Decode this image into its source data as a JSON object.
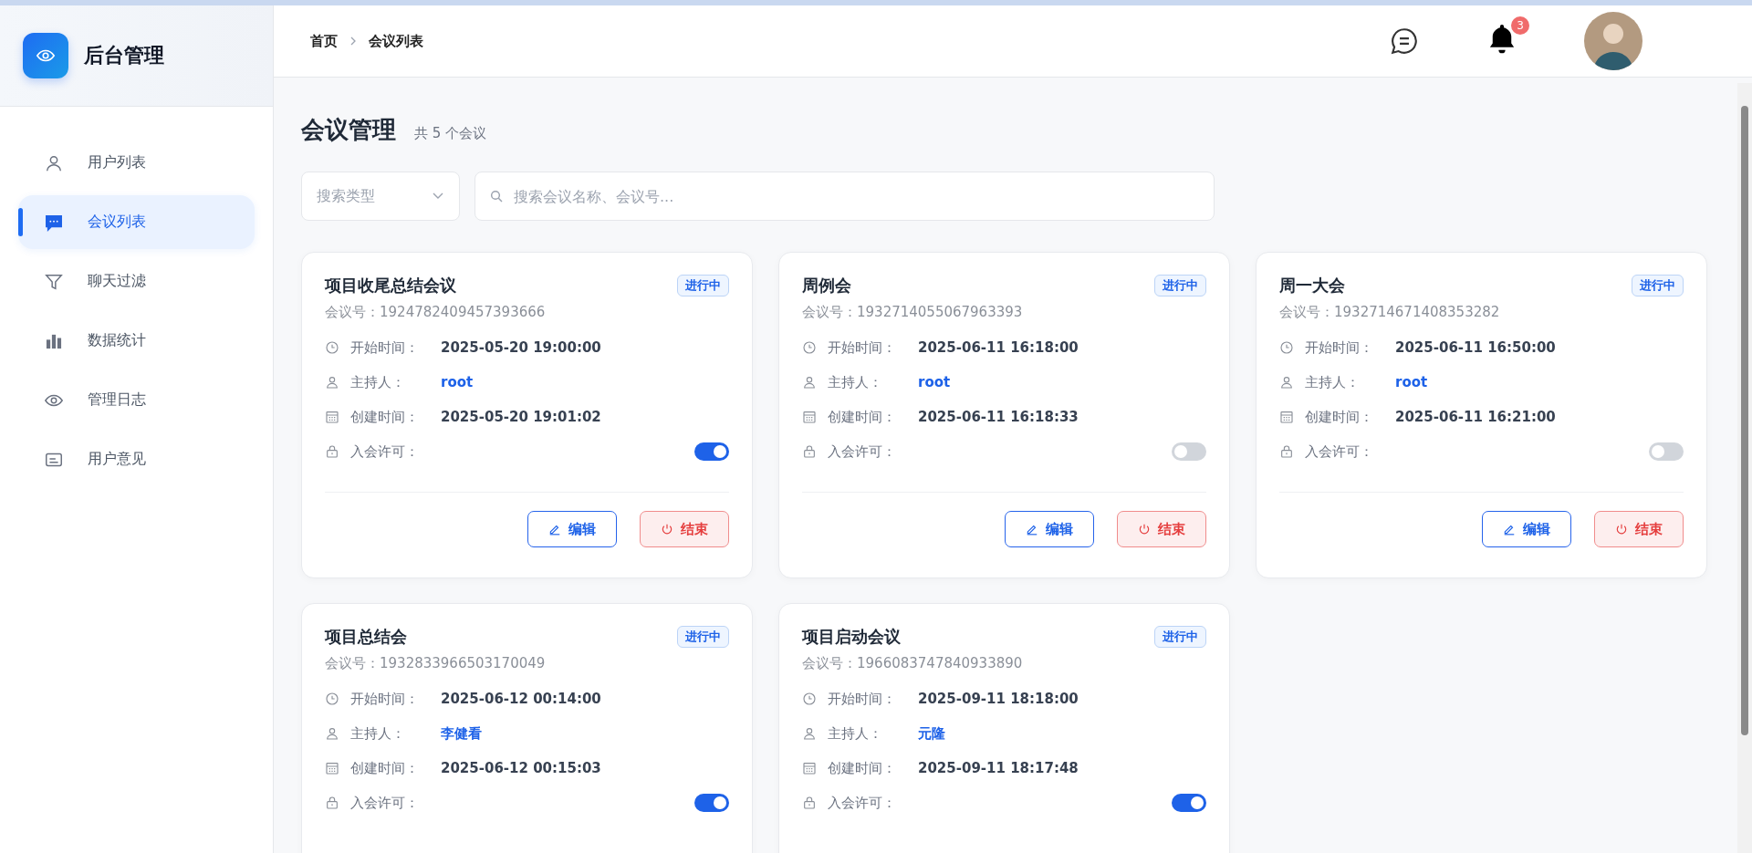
{
  "sidebar": {
    "brand": "后台管理",
    "items": [
      {
        "label": "用户列表",
        "selected": false
      },
      {
        "label": "会议列表",
        "selected": true
      },
      {
        "label": "聊天过滤",
        "selected": false
      },
      {
        "label": "数据统计",
        "selected": false
      },
      {
        "label": "管理日志",
        "selected": false
      },
      {
        "label": "用户意见",
        "selected": false
      }
    ]
  },
  "header": {
    "breadcrumb": [
      "首页",
      "会议列表"
    ],
    "notification_count": "3"
  },
  "page": {
    "title": "会议管理",
    "count": "共 5 个会议"
  },
  "filters": {
    "type_placeholder": "搜索类型",
    "search_placeholder": "搜索会议名称、会议号..."
  },
  "meetings": [
    {
      "name": "项目收尾总结会议",
      "status": "进行中",
      "id_label": "会议号：",
      "id": "1924782409457393666",
      "start_label": "开始时间：",
      "start": "2025-05-20 19:00:00",
      "host_label": "主持人：",
      "host": "root",
      "created_label": "创建时间：",
      "created": "2025-05-20 19:01:02",
      "permission_label": "入会许可：",
      "permission_on": true,
      "actions": [
        "编辑",
        "结束"
      ]
    },
    {
      "name": "周例会",
      "status": "进行中",
      "id_label": "会议号：",
      "id": "1932714055067963393",
      "start_label": "开始时间：",
      "start": "2025-06-11 16:18:00",
      "host_label": "主持人：",
      "host": "root",
      "created_label": "创建时间：",
      "created": "2025-06-11 16:18:33",
      "permission_label": "入会许可：",
      "permission_on": false,
      "actions": [
        "编辑",
        "结束"
      ]
    },
    {
      "name": "周一大会",
      "status": "进行中",
      "id_label": "会议号：",
      "id": "1932714671408353282",
      "start_label": "开始时间：",
      "start": "2025-06-11 16:50:00",
      "host_label": "主持人：",
      "host": "root",
      "created_label": "创建时间：",
      "created": "2025-06-11 16:21:00",
      "permission_label": "入会许可：",
      "permission_on": false,
      "actions": [
        "编辑",
        "结束"
      ]
    },
    {
      "name": "项目总结会",
      "status": "进行中",
      "id_label": "会议号：",
      "id": "1932833966503170049",
      "start_label": "开始时间：",
      "start": "2025-06-12 00:14:00",
      "host_label": "主持人：",
      "host": "李健看",
      "created_label": "创建时间：",
      "created": "2025-06-12 00:15:03",
      "permission_label": "入会许可：",
      "permission_on": true
    },
    {
      "name": "项目启动会议",
      "status": "进行中",
      "id_label": "会议号：",
      "id": "1966083747840933890",
      "start_label": "开始时间：",
      "start": "2025-09-11 18:18:00",
      "host_label": "主持人：",
      "host": "元隆",
      "created_label": "创建时间：",
      "created": "2025-09-11 18:17:48",
      "permission_label": "入会许可：",
      "permission_on": true
    }
  ]
}
